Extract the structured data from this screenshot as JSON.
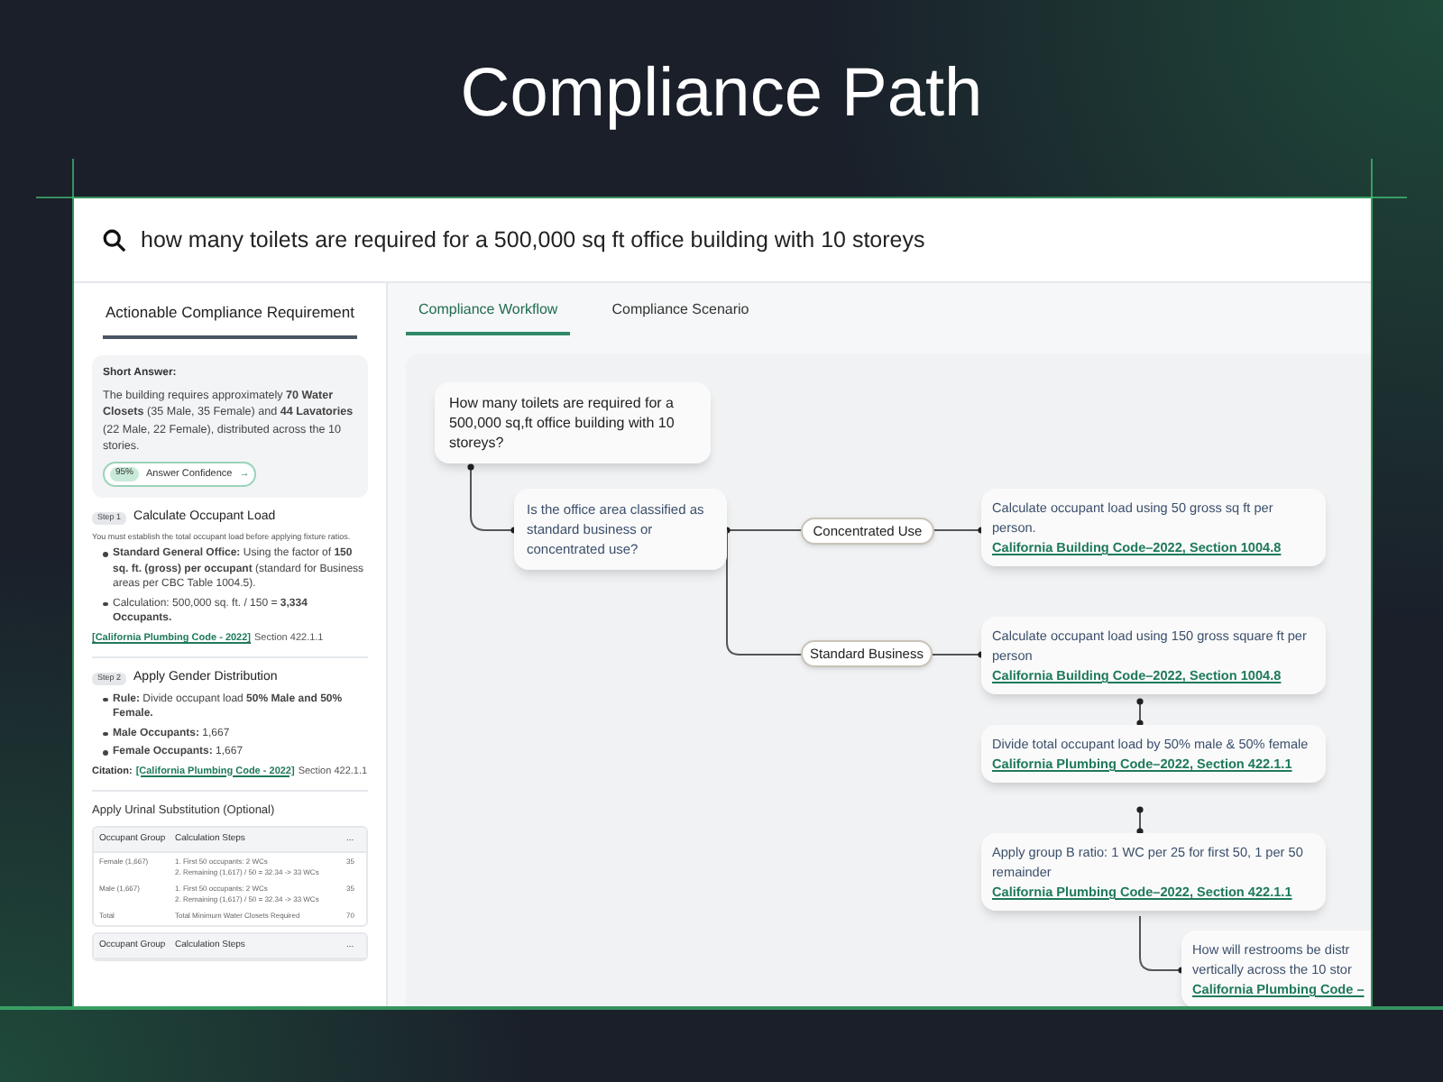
{
  "title": "Compliance Path",
  "search": {
    "value": "how many toilets are required for a 500,000 sq ft office building with 10 storeys"
  },
  "left_panel": {
    "tab": "Actionable Compliance Requirement",
    "short_answer": {
      "label": "Short Answer:",
      "text": "The building requires approximately **70 Water Closets** (35 Male, 35 Female) and **44 Lavatories** (22 Male, 22 Female), distributed across the 10 stories.",
      "confidence": {
        "score": "95%",
        "label": "Answer Confidence",
        "arrow": "→"
      }
    },
    "steps": [
      {
        "badge": "Step 1",
        "title": "Calculate Occupant Load",
        "note": "You must establish the total occupant load before applying fixture ratios.",
        "bullets": [
          "**Standard General Office:** Using the factor of **150 sq. ft. (gross) per occupant** (standard for Business areas per CBC Table 1004.5).",
          "Calculation: 500,000 sq. ft. / 150 = **3,334 Occupants.**"
        ],
        "citation": {
          "link": "[California Plumbing Code - 2022]",
          "section": "Section 422.1.1"
        }
      },
      {
        "badge": "Step 2",
        "title": "Apply Gender Distribution",
        "bullets": [
          "**Rule:** Divide occupant load **50% Male and 50% Female.**",
          "**Male Occupants:** 1,667",
          "**Female Occupants:** 1,667"
        ],
        "citation": {
          "prefix": "Citation:",
          "link": "[California Plumbing Code - 2022]",
          "section": "Section 422.1.1"
        }
      }
    ],
    "urinal_section": {
      "title": "Apply Urinal Substitution (Optional)",
      "tables": [
        {
          "columns": [
            "Occupant Group",
            "Calculation Steps",
            "..."
          ],
          "rows": [
            [
              "Female (1,667)",
              "1. First 50 occupants: 2 WCs\n2. Remaining (1,617) / 50 = 32.34 -> 33 WCs",
              "35"
            ],
            [
              "Male (1,667)",
              "1. First 50 occupants: 2 WCs\n2. Remaining (1,617) / 50 = 32.34 -> 33 WCs",
              "35"
            ],
            [
              "Total",
              "Total Minimum Water Closets Required",
              "70"
            ]
          ]
        },
        {
          "columns": [
            "Occupant Group",
            "Calculation Steps",
            "..."
          ]
        }
      ]
    }
  },
  "tabs": [
    {
      "label": "Compliance Workflow",
      "selected": true
    },
    {
      "label": "Compliance Scenario",
      "selected": false
    }
  ],
  "workflow": {
    "nodes": [
      {
        "kind": "question",
        "lines": [
          "How many toilets are required for a 500,000 sq,ft office building with 10 storeys?"
        ]
      },
      {
        "kind": "decision",
        "lines": [
          "Is the office area classified as standard business or concentrated use?"
        ]
      },
      {
        "kind": "branch",
        "lines": [
          "Concentrated Use"
        ]
      },
      {
        "kind": "step",
        "lines": [
          "Calculate occupant load using 50 gross sq ft per person."
        ],
        "link": "California Building Code–2022, Section 1004.8"
      },
      {
        "kind": "branch",
        "lines": [
          "Standard Business"
        ]
      },
      {
        "kind": "step",
        "lines": [
          "Calculate occupant load using 150 gross square ft per person"
        ],
        "link": "California Building Code–2022, Section 1004.8"
      },
      {
        "kind": "step",
        "lines": [
          "Divide total occupant load by 50% male & 50% female"
        ],
        "link": "California Plumbing Code–2022, Section 422.1.1"
      },
      {
        "kind": "step",
        "lines": [
          "Apply group B ratio: 1 WC per 25 for first 50, 1 per 50 remainder"
        ],
        "link": "California Plumbing Code–2022, Section 422.1.1"
      },
      {
        "kind": "step",
        "lines": [
          "How will restrooms be distr",
          "vertically across the 10 stor"
        ],
        "link": "California Plumbing Code –"
      }
    ]
  }
}
